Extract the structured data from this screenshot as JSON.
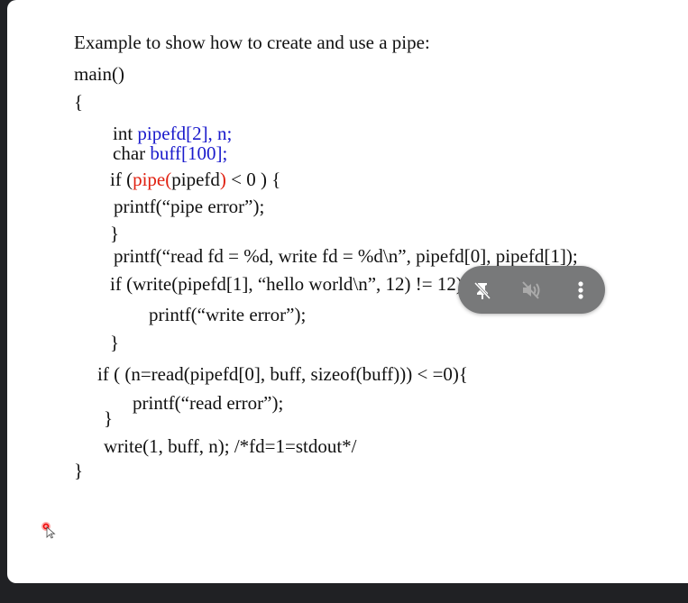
{
  "document": {
    "heading": "Example to show how to create and use a pipe:",
    "lines": [
      {
        "segments": [
          {
            "t": "main()",
            "c": ""
          }
        ]
      },
      {
        "segments": [
          {
            "t": "{",
            "c": ""
          }
        ]
      },
      {
        "segments": [
          {
            "t": "int ",
            "c": ""
          },
          {
            "t": "pipefd[2], n;",
            "c": "blue"
          }
        ]
      },
      {
        "segments": [
          {
            "t": "char ",
            "c": ""
          },
          {
            "t": "buff[100];",
            "c": "blue"
          }
        ]
      },
      {
        "segments": [
          {
            "t": "if (",
            "c": ""
          },
          {
            "t": "pipe(",
            "c": "red"
          },
          {
            "t": "pipefd",
            "c": ""
          },
          {
            "t": ")",
            "c": "red"
          },
          {
            "t": " < 0 ) {",
            "c": ""
          }
        ]
      },
      {
        "segments": [
          {
            "t": "printf(“pipe error”);",
            "c": ""
          }
        ]
      },
      {
        "segments": [
          {
            "t": "}",
            "c": ""
          }
        ]
      },
      {
        "segments": [
          {
            "t": "printf(“read fd = %d, write fd = %d\\n”, pipefd[0], pipefd[1]);",
            "c": ""
          }
        ]
      },
      {
        "segments": [
          {
            "t": "if (write(pipefd[1], “hello world\\n”, 12) != 12)",
            "c": ""
          }
        ]
      },
      {
        "segments": [
          {
            "t": "printf(“write error”);",
            "c": ""
          }
        ]
      },
      {
        "segments": [
          {
            "t": "}",
            "c": ""
          }
        ]
      },
      {
        "segments": [
          {
            "t": "if ( (n=read(pipefd[0], buff, sizeof(buff))) < =0){",
            "c": ""
          }
        ]
      },
      {
        "segments": [
          {
            "t": "printf(“read error”);",
            "c": ""
          }
        ]
      },
      {
        "segments": [
          {
            "t": "}",
            "c": ""
          }
        ]
      },
      {
        "segments": [
          {
            "t": "write(1, buff, n); /*fd=1=stdout*/",
            "c": ""
          }
        ]
      },
      {
        "segments": [
          {
            "t": "}",
            "c": ""
          }
        ]
      }
    ]
  },
  "overlay": {
    "icons": [
      "unpin-icon",
      "volume-muted-icon",
      "more-vertical-icon"
    ]
  },
  "colors": {
    "blue": "#1a1acc",
    "red": "#e02010",
    "pill": "#78797a",
    "frame": "#202124"
  }
}
